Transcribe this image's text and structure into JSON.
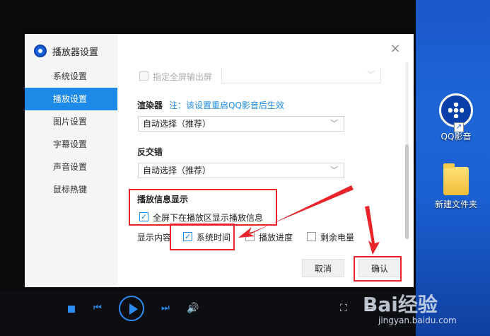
{
  "dialog": {
    "title": "播放器设置",
    "close_label": "×"
  },
  "sidebar": {
    "items": [
      {
        "label": "系统设置",
        "active": false
      },
      {
        "label": "播放设置",
        "active": true
      },
      {
        "label": "图片设置",
        "active": false
      },
      {
        "label": "字幕设置",
        "active": false
      },
      {
        "label": "声音设置",
        "active": false
      },
      {
        "label": "鼠标热键",
        "active": false
      }
    ]
  },
  "content": {
    "fullscreen_output": {
      "label": "指定全屏输出屏",
      "checked": false,
      "disabled": true
    },
    "renderer": {
      "title": "渲染器",
      "note": "注：该设置重启QQ影音后生效",
      "value": "自动选择（推荐）"
    },
    "deinterlace": {
      "title": "反交错",
      "value": "自动选择（推荐）"
    },
    "playback_info": {
      "title": "播放信息显示",
      "fullscreen_show": {
        "label": "全屏下在播放区显示播放信息",
        "checked": true
      },
      "display_content_label": "显示内容",
      "options": [
        {
          "label": "系统时间",
          "checked": true
        },
        {
          "label": "播放进度",
          "checked": false
        },
        {
          "label": "剩余电量",
          "checked": false
        }
      ]
    }
  },
  "buttons": {
    "cancel": "取消",
    "confirm": "确认"
  },
  "desktop": {
    "icons": [
      {
        "label": "QQ影音"
      },
      {
        "label": "新建文件夹"
      }
    ]
  },
  "watermark": {
    "brand": "Bai经验",
    "url": "jingyan.baidu.com"
  },
  "colors": {
    "accent": "#1e8ae8",
    "annotation": "#e8242a",
    "note_text": "#1e8ae8"
  }
}
